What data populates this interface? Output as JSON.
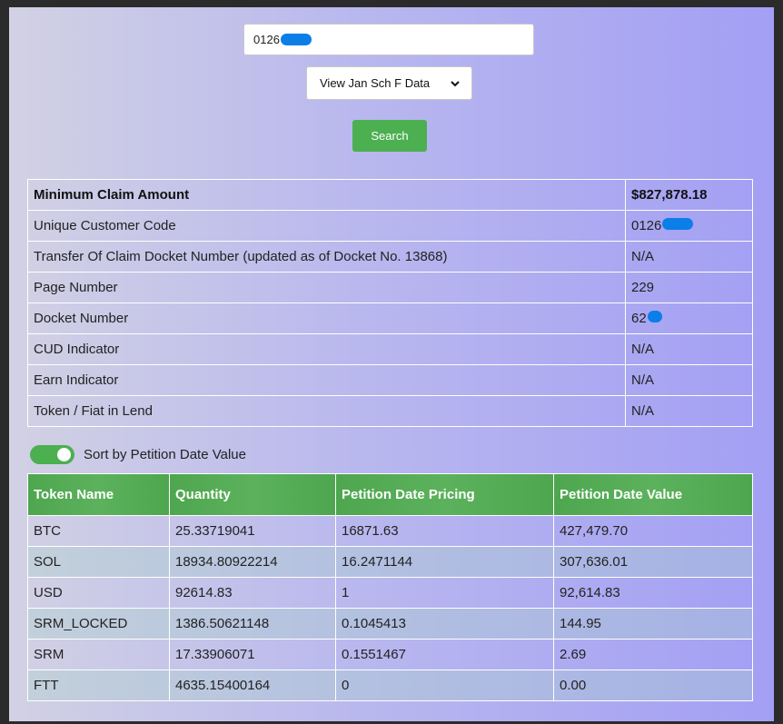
{
  "search": {
    "value": "0126"
  },
  "select": {
    "selected": "View Jan Sch F Data"
  },
  "search_button": {
    "label": "Search"
  },
  "info": [
    {
      "label": "Minimum Claim Amount",
      "value": "$827,878.18",
      "bold": true
    },
    {
      "label": "Unique Customer Code",
      "value": "0126",
      "redacted": true
    },
    {
      "label": "Transfer Of Claim Docket Number (updated as of Docket No. 13868)",
      "value": "N/A"
    },
    {
      "label": "Page Number",
      "value": "229"
    },
    {
      "label": "Docket Number",
      "value": "62",
      "redacted": true
    },
    {
      "label": "CUD Indicator",
      "value": "N/A"
    },
    {
      "label": "Earn Indicator",
      "value": "N/A"
    },
    {
      "label": "Token / Fiat in Lend",
      "value": "N/A"
    }
  ],
  "sort_toggle": {
    "label": "Sort by Petition Date Value",
    "on": true
  },
  "tokens": {
    "headers": [
      "Token Name",
      "Quantity",
      "Petition Date Pricing",
      "Petition Date Value"
    ],
    "rows": [
      [
        "BTC",
        "25.33719041",
        "16871.63",
        "427,479.70"
      ],
      [
        "SOL",
        "18934.80922214",
        "16.2471144",
        "307,636.01"
      ],
      [
        "USD",
        "92614.83",
        "1",
        "92,614.83"
      ],
      [
        "SRM_LOCKED",
        "1386.50621148",
        "0.1045413",
        "144.95"
      ],
      [
        "SRM",
        "17.33906071",
        "0.1551467",
        "2.69"
      ],
      [
        "FTT",
        "4635.15400164",
        "0",
        "0.00"
      ]
    ]
  },
  "colors": {
    "accent": "#4caf50",
    "redaction": "#0b7ee8"
  }
}
